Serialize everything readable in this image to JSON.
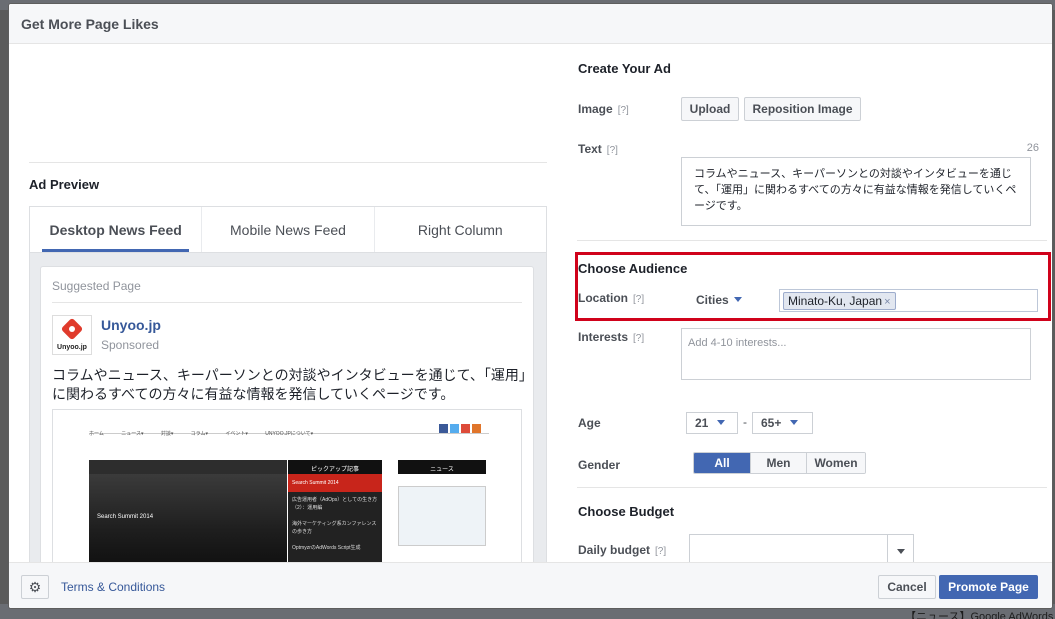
{
  "background": {
    "snippet": "【ニュース】Google AdWords"
  },
  "dialog": {
    "title": "Get More Page Likes"
  },
  "preview": {
    "label": "Ad Preview",
    "tabs": [
      {
        "label": "Desktop News Feed",
        "active": true
      },
      {
        "label": "Mobile News Feed",
        "active": false
      },
      {
        "label": "Right Column",
        "active": false
      }
    ],
    "suggested": "Suggested Page",
    "page_name": "Unyoo.jp",
    "logo_text": "Unyoo.jp",
    "sponsored": "Sponsored",
    "body_text": "コラムやニュース、キーパーソンとの対談やインタビューを通じて、「運用」に関わるすべての方々に有益な情報を発信していくページです。",
    "screenshot": {
      "nav": [
        "ホーム",
        "ニュース▾",
        "対談▾",
        "コラム▾",
        "イベント▾",
        "UNYOO.JPについて▾"
      ],
      "main_caption": "Search Summit 2014",
      "side_head": "ピックアップ記事",
      "side_highlight": "Search Summit 2014",
      "side_items": [
        "広告運用者（AdOps）としての生き方（2）：運用編",
        "海外マーケティング系カンファレンスの歩き方",
        "OptmyzrのAdWords Script生成"
      ],
      "right_head": "ニュース",
      "social_colors": [
        "#3b5998",
        "#55acee",
        "#dd4b39",
        "#e0752b"
      ]
    }
  },
  "create_ad": {
    "heading": "Create Your Ad",
    "image_label": "Image",
    "help": "[?]",
    "upload": "Upload",
    "reposition": "Reposition Image",
    "text_label": "Text",
    "char_count": "26",
    "ad_text": "コラムやニュース、キーパーソンとの対談やインタビューを通じて、「運用」に関わるすべての方々に有益な情報を発信していくページです。"
  },
  "audience": {
    "heading": "Choose Audience",
    "location_label": "Location",
    "location_type": "Cities",
    "location_value": "Minato-Ku, Japan",
    "token_remove": "×",
    "interests_label": "Interests",
    "interests_placeholder": "Add 4-10 interests...",
    "age_label": "Age",
    "age_min": "21",
    "age_sep": "-",
    "age_max": "65+",
    "gender_label": "Gender",
    "genders": [
      "All",
      "Men",
      "Women"
    ],
    "gender_selected": "All"
  },
  "budget": {
    "heading": "Choose Budget",
    "daily_label": "Daily budget",
    "daily_value": ""
  },
  "footer": {
    "terms": "Terms & Conditions",
    "cancel": "Cancel",
    "promote": "Promote Page"
  },
  "colors": {
    "highlight_box": "#d0021b",
    "primary": "#4267b2",
    "link": "#365899"
  }
}
